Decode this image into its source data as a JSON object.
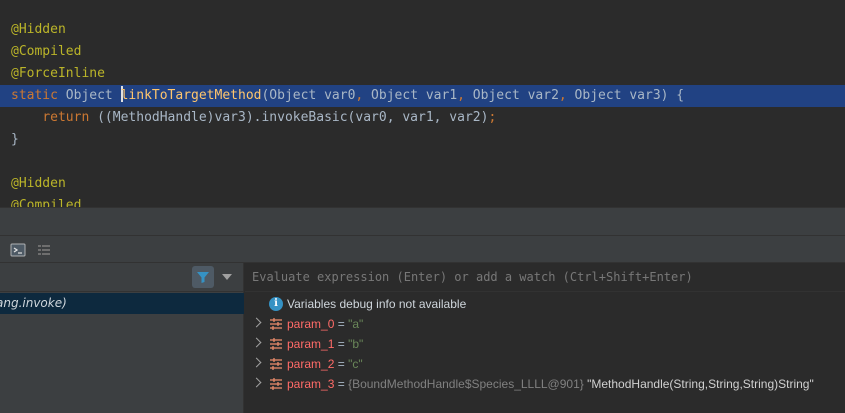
{
  "editor": {
    "lines": [
      {
        "annotation": "@Hidden"
      },
      {
        "annotation": "@Compiled"
      },
      {
        "annotation": "@ForceInline"
      },
      {
        "kw_static": "static",
        "type_object": "Object",
        "method_name": "linkToTargetMethod",
        "params_open": "(Object var0",
        "comma1": ",",
        "p1": " Object var1",
        "comma2": ",",
        "p2": " Object var2",
        "comma3": ",",
        "p3": " Object var3) {"
      },
      {
        "kw_return": "return",
        "expr": " ((MethodHandle)var3).invokeBasic(var0, var1, var2)",
        "semicolon": ";"
      },
      {
        "close": "}"
      },
      {
        "annotation": "@Hidden"
      },
      {
        "annotation": "@Compiled"
      }
    ]
  },
  "frames": {
    "selected_frame": "ang.invoke)"
  },
  "variables": {
    "eval_placeholder": "Evaluate expression (Enter) or add a watch (Ctrl+Shift+Enter)",
    "info_message": "Variables debug info not available",
    "items": [
      {
        "name": "param_0",
        "eq": " = ",
        "value": "\"a\""
      },
      {
        "name": "param_1",
        "eq": " = ",
        "value": "\"b\""
      },
      {
        "name": "param_2",
        "eq": " = ",
        "value": "\"c\""
      },
      {
        "name": "param_3",
        "eq": " = ",
        "ref": "{BoundMethodHandle$Species_LLLL@901}",
        "desc": " \"MethodHandle(String,String,String)String\""
      }
    ]
  },
  "colors": {
    "editor_bg": "#2b2b2b",
    "selection_line": "#214283",
    "annotation": "#bbb529",
    "keyword": "#cc7832",
    "method": "#ffc66d",
    "var_name": "#ff6b68",
    "string_value": "#6a8759"
  },
  "icons": {
    "console": "console-icon",
    "threads": "list-icon",
    "filter": "filter-icon",
    "info": "info-icon",
    "parameter": "parameter-icon"
  }
}
